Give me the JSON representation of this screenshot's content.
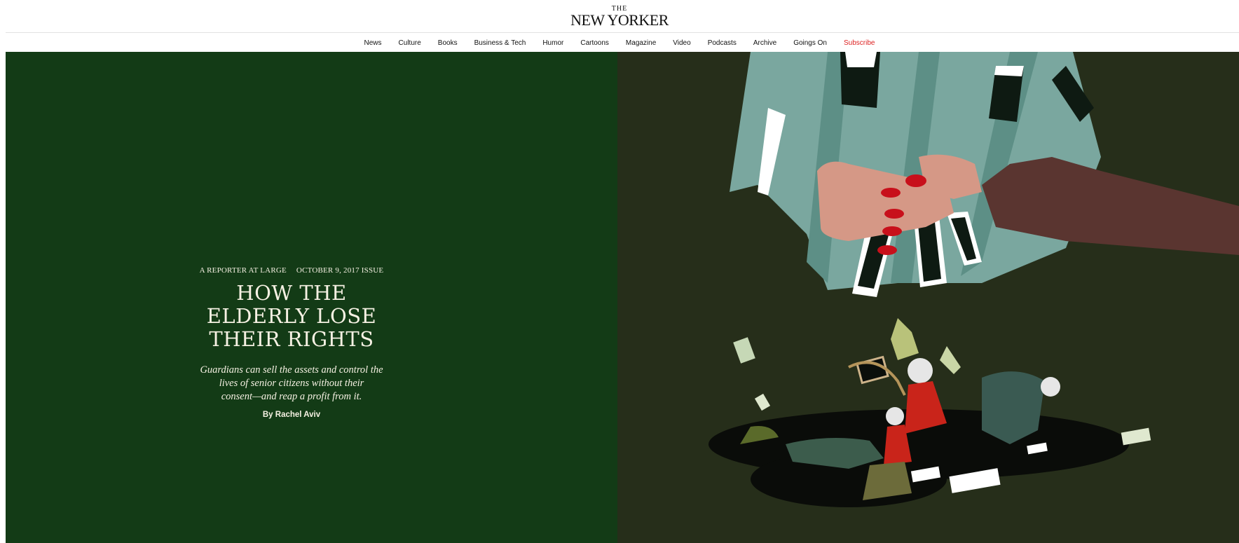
{
  "header": {
    "logo_the": "THE",
    "logo_name": "NEW YORKER"
  },
  "nav": {
    "items": [
      "News",
      "Culture",
      "Books",
      "Business & Tech",
      "Humor",
      "Cartoons",
      "Magazine",
      "Video",
      "Podcasts",
      "Archive",
      "Goings On",
      "Subscribe"
    ]
  },
  "article": {
    "rubric": "A REPORTER AT LARGE",
    "issue": "OCTOBER 9, 2017 ISSUE",
    "headline_1": "HOW THE",
    "headline_2": "ELDERLY LOSE",
    "headline_3": "THEIR RIGHTS",
    "dek_1": "Guardians can sell the assets and control the",
    "dek_2": "lives of senior citizens without their",
    "dek_3": "consent—and reap a profit from it.",
    "byline": "By Rachel Aviv"
  },
  "colors": {
    "hero_left_bg": "#133b16",
    "hero_right_bg": "#262e1a",
    "subscribe": "#dd2222",
    "house": "#7aa79f",
    "nails": "#c8101b"
  }
}
